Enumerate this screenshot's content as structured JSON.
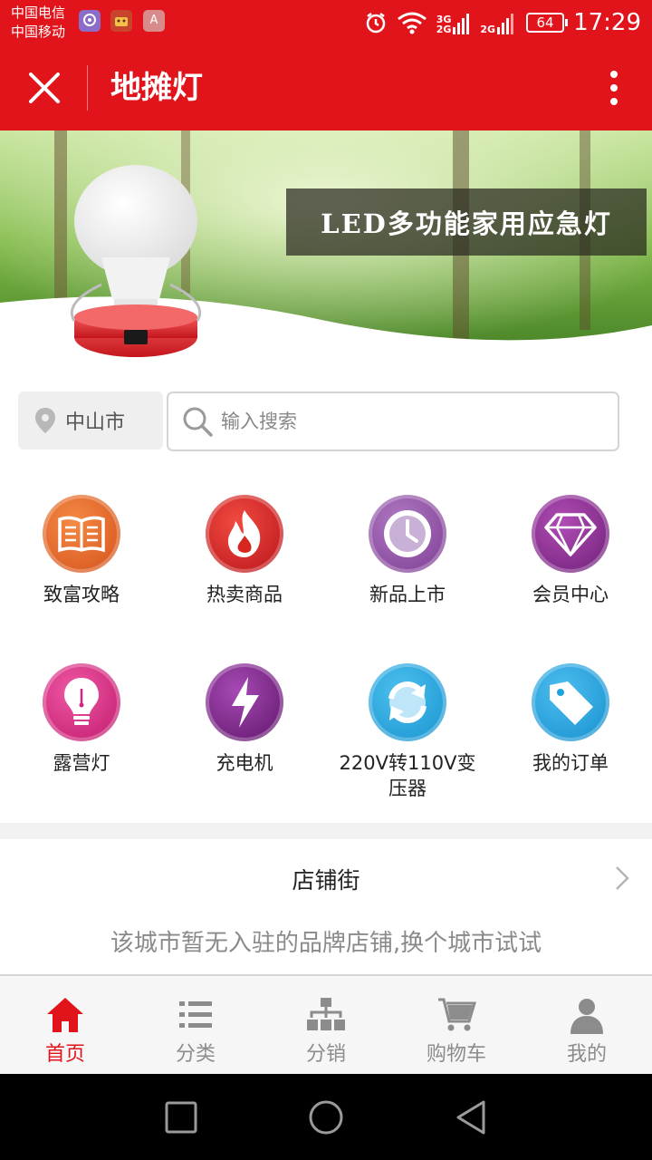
{
  "status_bar": {
    "carrier_1": "中国电信",
    "carrier_2": "中国移动",
    "network_1": "3G",
    "network_2": "2G",
    "network_3": "2G",
    "battery": "64",
    "time": "17:29",
    "app_3_letter": "A"
  },
  "titlebar": {
    "title": "地摊灯",
    "close_icon": "close-icon",
    "more_icon": "more-vertical-icon"
  },
  "banner": {
    "text": "LED多功能家用应急灯"
  },
  "search": {
    "city": "中山市",
    "placeholder": "输入搜索"
  },
  "grid": [
    {
      "label": "致富攻略",
      "icon": "book-icon",
      "color": "#e4621d"
    },
    {
      "label": "热卖商品",
      "icon": "flame-icon",
      "color": "#d7261f"
    },
    {
      "label": "新品上市",
      "icon": "clock-icon",
      "color": "#8e4da2"
    },
    {
      "label": "会员中心",
      "icon": "diamond-icon",
      "color": "#8a2c8e"
    },
    {
      "label": "露营灯",
      "icon": "lightbulb-icon",
      "color": "#d6247e"
    },
    {
      "label": "充电机",
      "icon": "lightning-icon",
      "color": "#7d2388"
    },
    {
      "label": "220V转110V变压器",
      "icon": "refresh-icon",
      "color": "#1ea8e2"
    },
    {
      "label": "我的订单",
      "icon": "tag-icon",
      "color": "#1ea3e0"
    }
  ],
  "shop_street": {
    "title": "店铺街",
    "empty_message": "该城市暂无入驻的品牌店铺,换个城市试试"
  },
  "bottom_nav": [
    {
      "label": "首页",
      "icon": "home-icon",
      "active": true
    },
    {
      "label": "分类",
      "icon": "list-icon",
      "active": false
    },
    {
      "label": "分销",
      "icon": "hierarchy-icon",
      "active": false
    },
    {
      "label": "购物车",
      "icon": "cart-icon",
      "active": false
    },
    {
      "label": "我的",
      "icon": "user-icon",
      "active": false
    }
  ],
  "colors": {
    "brand_red": "#e2141b"
  }
}
